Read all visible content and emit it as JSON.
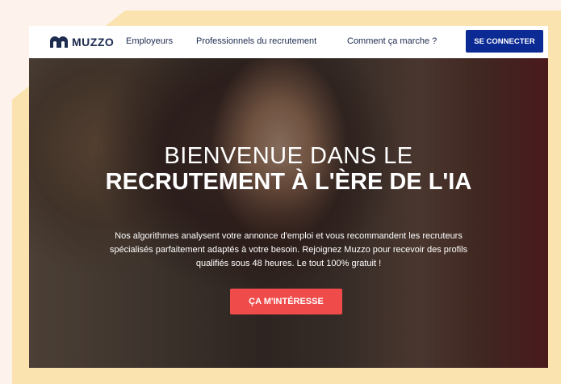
{
  "nav": {
    "logo_text": "MUZZO",
    "links": [
      {
        "label": "Employeurs"
      },
      {
        "label": "Professionnels du recrutement"
      },
      {
        "label": "Comment ça marche ?"
      }
    ],
    "login_label": "SE CONNECTER"
  },
  "hero": {
    "title_line1": "BIENVENUE DANS LE",
    "title_line2": "RECRUTEMENT À L'ÈRE DE L'IA",
    "subtitle": "Nos algorithmes analysent votre annonce d'emploi et vous recommandent les recruteurs spécialisés parfaitement adaptés à votre besoin. Rejoignez Muzzo pour recevoir des profils qualifiés sous 48 heures. Le tout 100% gratuit !",
    "cta_label": "ÇA M'INTÉRESSE"
  },
  "colors": {
    "brand_navy": "#1d2b4f",
    "login_button": "#0b2a93",
    "cta_button": "#ef4b4b",
    "decor_yellow": "#fbe3b0",
    "page_background": "#fdf3ec"
  }
}
